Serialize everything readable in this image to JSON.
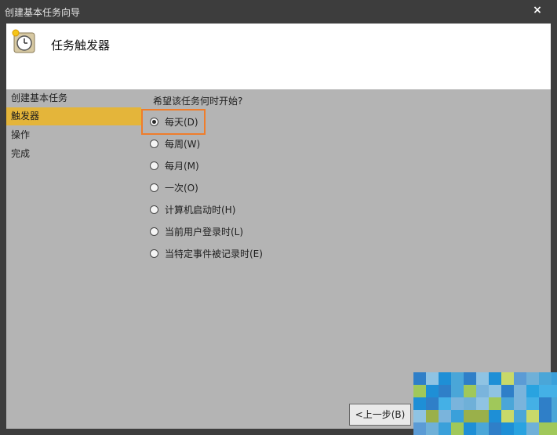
{
  "window": {
    "title": "创建基本任务向导",
    "close_glyph": "×"
  },
  "header": {
    "title": "任务触发器",
    "icon": "clock-icon"
  },
  "nav": {
    "items": [
      {
        "label": "创建基本任务",
        "active": false
      },
      {
        "label": "触发器",
        "active": true
      },
      {
        "label": "操作",
        "active": false
      },
      {
        "label": "完成",
        "active": false
      }
    ]
  },
  "main": {
    "question": "希望该任务何时开始?",
    "selected": "每天(D)",
    "options": [
      {
        "label": "每天(D)",
        "checked": true
      },
      {
        "label": "每周(W)",
        "checked": false
      },
      {
        "label": "每月(M)",
        "checked": false
      },
      {
        "label": "一次(O)",
        "checked": false
      },
      {
        "label": "计算机启动时(H)",
        "checked": false
      },
      {
        "label": "当前用户登录时(L)",
        "checked": false
      },
      {
        "label": "当特定事件被记录时(E)",
        "checked": false
      }
    ]
  },
  "footer": {
    "back_label": "<上一步(B)"
  },
  "colors": {
    "active_nav": "#e4b53a",
    "highlight": "#ef7d2b",
    "content_bg": "#b4b4b4"
  }
}
